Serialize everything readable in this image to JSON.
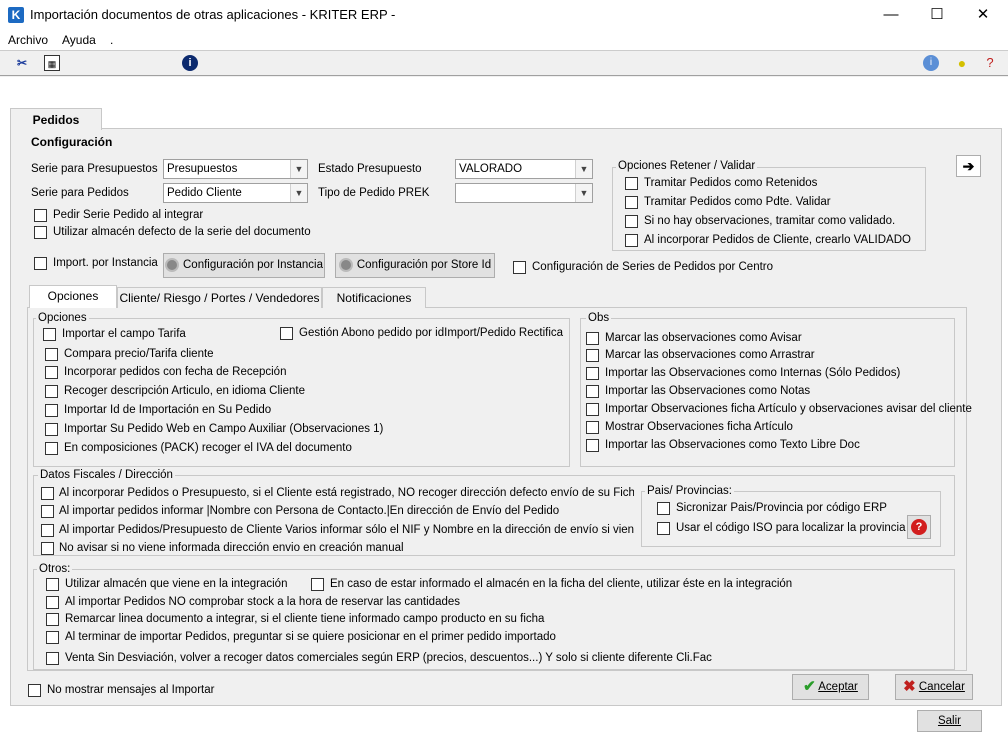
{
  "window": {
    "title": "Importación documentos de otras aplicaciones - KRITER ERP -",
    "app_icon": "K",
    "minimize": "—",
    "maximize": "☐",
    "close": "✕"
  },
  "menu": {
    "archivo": "Archivo",
    "ayuda": "Ayuda",
    "dot": "."
  },
  "toolbar": {
    "info": "i"
  },
  "tabs": {
    "pedidos": "Pedidos"
  },
  "config": {
    "heading": "Configuración",
    "serie_presupuestos_label": "Serie para Presupuestos",
    "serie_presupuestos_value": "Presupuestos",
    "serie_pedidos_label": "Serie para Pedidos",
    "serie_pedidos_value": "Pedido Cliente",
    "estado_presupuesto_label": "Estado Presupuesto",
    "estado_presupuesto_value": "VALORADO",
    "tipo_pedido_label": "Tipo de Pedido PREK",
    "tipo_pedido_value": "",
    "pedir_serie": "Pedir Serie Pedido al integrar",
    "utilizar_almacen": "Utilizar almacén defecto de la serie del documento",
    "import_instancia": "Import. por Instancia",
    "btn_config_instancia": "Configuración por Instancia",
    "btn_config_store": "Configuración por Store Id",
    "config_series_centro": "Configuración de Series de Pedidos por Centro"
  },
  "retener": {
    "title": "Opciones Retener / Validar",
    "items": [
      "Tramitar Pedidos como Retenidos",
      "Tramitar Pedidos como Pdte. Validar",
      "Si no hay observaciones, tramitar como validado.",
      "Al incorporar Pedidos de Cliente, crearlo VALIDADO"
    ]
  },
  "subtabs": {
    "opciones": "Opciones",
    "cliente": "Cliente/ Riesgo / Portes / Vendedores",
    "notificaciones": "Notificaciones"
  },
  "opciones": {
    "title": "Opciones",
    "items": [
      "Importar el campo Tarifa",
      "Compara precio/Tarifa cliente",
      "Incorporar pedidos con fecha de Recepción",
      "Recoger descripción Articulo, en idioma Cliente",
      "Importar Id de Importación en Su Pedido",
      "Importar Su Pedido Web en Campo Auxiliar (Observaciones 1)",
      "En composiciones (PACK) recoger el IVA del documento"
    ],
    "gestion_abono": "Gestión Abono pedido por idImport/Pedido Rectifica"
  },
  "obs": {
    "title": "Obs",
    "items": [
      "Marcar las observaciones como Avisar",
      "Marcar las observaciones como Arrastrar",
      "Importar las Observaciones como Internas (Sólo Pedidos)",
      "Importar las Observaciones como Notas",
      "Importar Observaciones ficha Artículo y observaciones avisar del cliente",
      "Mostrar Observaciones ficha Artículo",
      "Importar las Observaciones como Texto Libre Doc"
    ]
  },
  "fiscales": {
    "title": "Datos Fiscales / Dirección",
    "items": [
      "Al incorporar Pedidos o Presupuesto, si el Cliente está registrado, NO recoger dirección defecto envío de su Ficha.",
      "Al importar pedidos informar |Nombre con Persona de Contacto.|En dirección de Envío del Pedido",
      "Al importar Pedidos/Presupuesto de Cliente Varios informar sólo el NIF y Nombre en la dirección de envío si viene informado",
      "No avisar si no viene informada dirección envio en creación manual"
    ]
  },
  "pais": {
    "title": "Pais/ Provincias:",
    "items": [
      "Sicronizar Pais/Provincia por código ERP",
      "Usar el código ISO para localizar la provincia"
    ],
    "help": "?"
  },
  "otros": {
    "title": "Otros:",
    "items": [
      "Utilizar almacén que viene en la integración",
      "Al importar Pedidos NO comprobar stock a la hora de reservar las cantidades",
      "Remarcar linea documento a integrar, si el cliente tiene informado campo producto en su ficha",
      "Al terminar de importar Pedidos, preguntar si se quiere posicionar en el primer pedido importado",
      "Venta Sin Desviación, volver a recoger datos comerciales según ERP (precios, descuentos...) Y solo si cliente diferente Cli.Fac"
    ],
    "almacen_ficha": "En caso de estar informado el almacén en la ficha del cliente, utilizar éste en la integración"
  },
  "footer": {
    "no_mostrar": "No mostrar mensajes al Importar",
    "aceptar": "Aceptar",
    "cancelar": "Cancelar",
    "salir": "Salir"
  },
  "colors": {
    "accent": "#1c6ac2",
    "ok": "#2a9d2a",
    "cancel": "#c0201e"
  }
}
